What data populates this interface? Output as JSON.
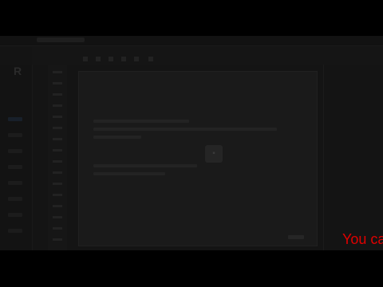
{
  "screen": {
    "caption": "You ca",
    "caption_color": "#e00000"
  },
  "app": {
    "logo_glyph": "R",
    "modal": {
      "title": "",
      "subtitle": ""
    },
    "center_button_icon": "image-icon"
  },
  "colors": {
    "background": "#000000",
    "dimmed_overlay": "#141414"
  }
}
